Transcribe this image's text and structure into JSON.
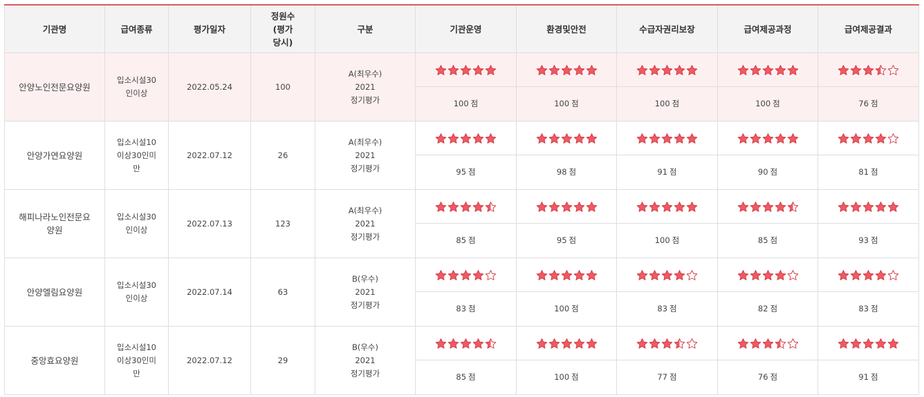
{
  "headers": [
    "기관명",
    "급여종류",
    "평가일자",
    "정원수\n(평가\n당시)",
    "구분",
    "기관운영",
    "환경및안전",
    "수급자권리보장",
    "급여제공과정",
    "급여제공결과"
  ],
  "score_unit": "점",
  "colors": {
    "accent": "#e0575f",
    "star_fill": "#ee5a63",
    "star_stroke": "#d33c45",
    "highlight_row": "#fdf0f1",
    "header_bg": "#f3f3f3"
  },
  "rows": [
    {
      "name": "안양노인전문요양원",
      "type": "입소시설30\n인이상",
      "date": "2022.05.24",
      "capacity": "100",
      "grade": "A(최우수)\n2021\n정기평가",
      "stars": [
        5,
        5,
        5,
        5,
        3.5
      ],
      "scores": [
        100,
        100,
        100,
        100,
        76
      ],
      "highlighted": true
    },
    {
      "name": "안양가연요양원",
      "type": "입소시설10\n이상30인미\n만",
      "date": "2022.07.12",
      "capacity": "26",
      "grade": "A(최우수)\n2021\n정기평가",
      "stars": [
        5,
        5,
        5,
        5,
        4
      ],
      "scores": [
        95,
        98,
        91,
        90,
        81
      ],
      "highlighted": false
    },
    {
      "name": "해피나라노인전문요\n양원",
      "type": "입소시설30\n인이상",
      "date": "2022.07.13",
      "capacity": "123",
      "grade": "A(최우수)\n2021\n정기평가",
      "stars": [
        4.5,
        5,
        5,
        4.5,
        5
      ],
      "scores": [
        85,
        95,
        100,
        85,
        93
      ],
      "highlighted": false
    },
    {
      "name": "안양엘림요양원",
      "type": "입소시설30\n인이상",
      "date": "2022.07.14",
      "capacity": "63",
      "grade": "B(우수)\n2021\n정기평가",
      "stars": [
        4,
        5,
        4,
        4,
        4
      ],
      "scores": [
        83,
        100,
        83,
        82,
        83
      ],
      "highlighted": false
    },
    {
      "name": "중앙효요양원",
      "type": "입소시설10\n이상30인미\n만",
      "date": "2022.07.12",
      "capacity": "29",
      "grade": "B(우수)\n2021\n정기평가",
      "stars": [
        4.5,
        5,
        3.5,
        3.5,
        5
      ],
      "scores": [
        85,
        100,
        77,
        76,
        91
      ],
      "highlighted": false
    }
  ]
}
